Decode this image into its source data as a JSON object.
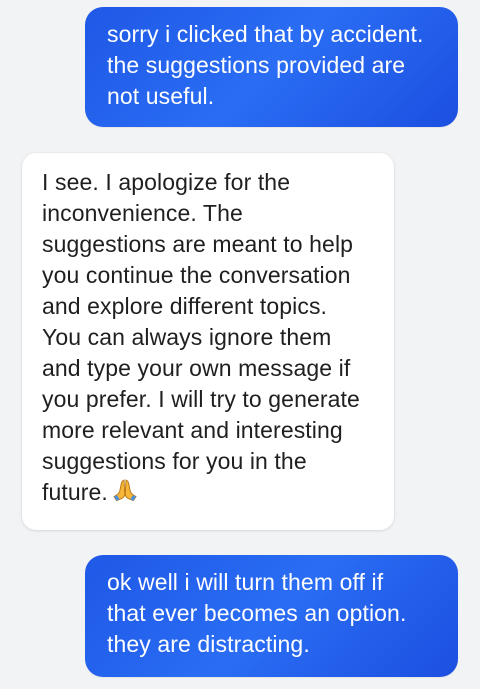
{
  "messages": [
    {
      "role": "user",
      "text": "sorry i clicked that by accident.\nthe suggestions provided are\nnot useful."
    },
    {
      "role": "assistant",
      "text": "I see. I apologize for the\ninconvenience. The\nsuggestions are meant to help\nyou continue the conversation\nand explore different topics.\nYou can always ignore them\nand type your own message if\nyou prefer. I will try to generate\nmore relevant and interesting\nsuggestions for you in the\nfuture.",
      "trailing_icon": "folded-hands-emoji"
    },
    {
      "role": "user",
      "text": "ok well i will turn them off if\nthat ever becomes an option.\nthey are distracting."
    }
  ],
  "colors": {
    "background": "#f2f3f5",
    "user_bubble": "#2a6df4",
    "assistant_bubble": "#ffffff",
    "assistant_text": "#1f1f1f",
    "user_text": "#ffffff"
  }
}
